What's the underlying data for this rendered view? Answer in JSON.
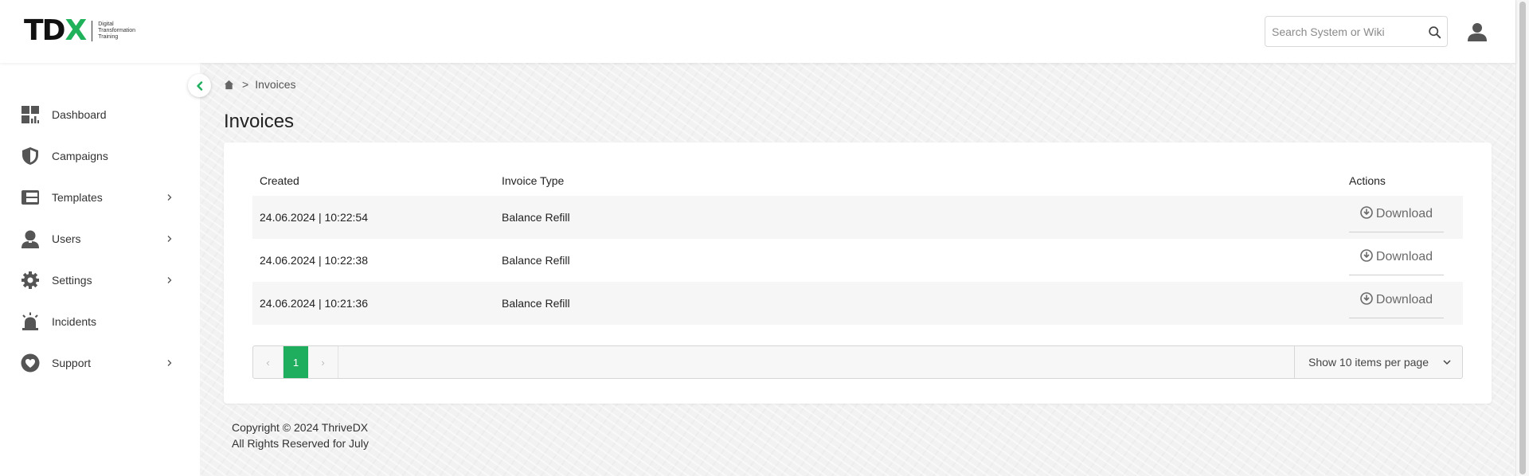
{
  "brand": {
    "logo_t": "T",
    "logo_d": "D",
    "logo_x": "X",
    "logo_sub_1": "Digital",
    "logo_sub_2": "Transformation",
    "logo_sub_3": "Training",
    "accent_color": "#1fb25a"
  },
  "header": {
    "search_placeholder": "Search System or Wiki",
    "search_icon": "search-icon",
    "user_icon": "user-icon"
  },
  "sidebar": {
    "items": [
      {
        "label": "Dashboard",
        "icon": "dashboard-icon",
        "has_submenu": false
      },
      {
        "label": "Campaigns",
        "icon": "shield-icon",
        "has_submenu": false
      },
      {
        "label": "Templates",
        "icon": "templates-icon",
        "has_submenu": true
      },
      {
        "label": "Users",
        "icon": "users-icon",
        "has_submenu": true
      },
      {
        "label": "Settings",
        "icon": "gear-icon",
        "has_submenu": true
      },
      {
        "label": "Incidents",
        "icon": "alarm-icon",
        "has_submenu": false
      },
      {
        "label": "Support",
        "icon": "heart-icon",
        "has_submenu": true
      }
    ]
  },
  "breadcrumb": {
    "separator": ">",
    "current": "Invoices"
  },
  "page": {
    "title": "Invoices"
  },
  "table": {
    "columns": [
      "Created",
      "Invoice Type",
      "Actions"
    ],
    "rows": [
      {
        "created": "24.06.2024 | 10:22:54",
        "type": "Balance Refill",
        "action": "Download"
      },
      {
        "created": "24.06.2024 | 10:22:38",
        "type": "Balance Refill",
        "action": "Download"
      },
      {
        "created": "24.06.2024 | 10:21:36",
        "type": "Balance Refill",
        "action": "Download"
      }
    ]
  },
  "pagination": {
    "prev": "‹",
    "next": "›",
    "current_page": "1",
    "per_page_label": "Show 10 items per page"
  },
  "footer": {
    "line1": "Copyright © 2024 ThriveDX",
    "line2": "All Rights Reserved for July"
  }
}
